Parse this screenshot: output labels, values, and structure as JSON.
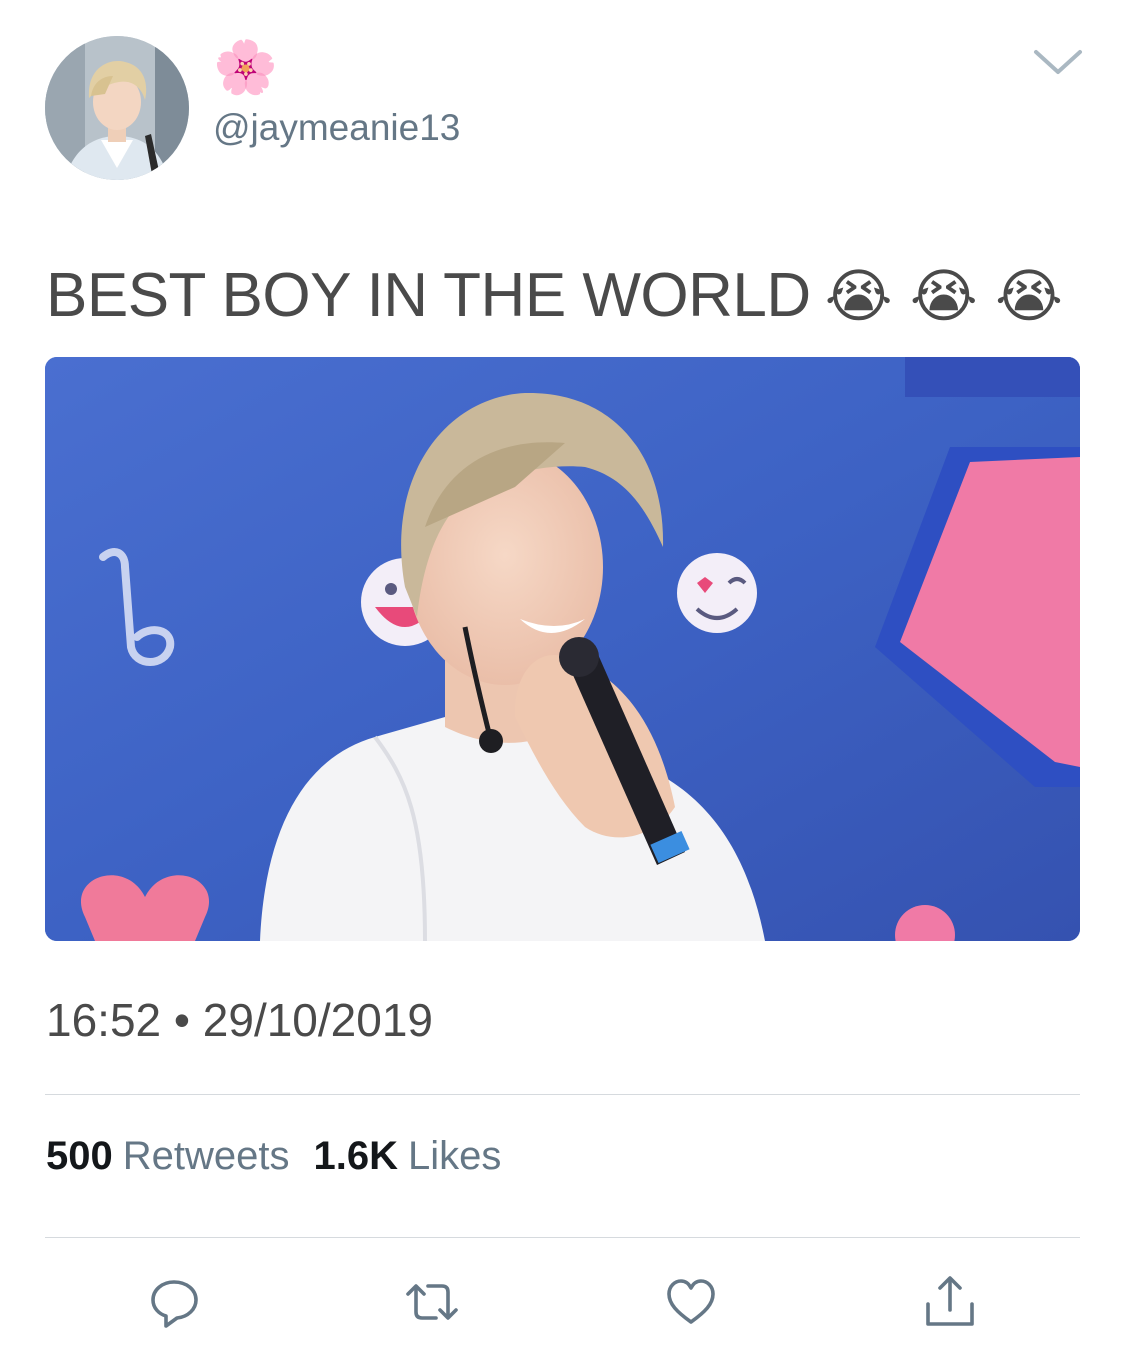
{
  "author": {
    "display_name": "🌸",
    "handle": "@jaymeanie13",
    "avatar_icon": "profile-photo"
  },
  "tweet": {
    "text": "BEST BOY IN THE WORLD",
    "emojis": "😭 😭 😭",
    "timestamp": "16:52 • 29/10/2019"
  },
  "stats": {
    "retweets_count": "500",
    "retweets_label": "Retweets",
    "likes_count": "1.6K",
    "likes_label": "Likes"
  },
  "icons": {
    "menu": "chevron-down-icon",
    "reply": "reply-bubble-icon",
    "retweet": "retweet-arrows-icon",
    "like": "heart-icon",
    "share": "share-upload-icon"
  },
  "colors": {
    "text": "#4a4a4a",
    "muted": "#657786",
    "divider": "#d6dade",
    "icon": "#657786"
  }
}
